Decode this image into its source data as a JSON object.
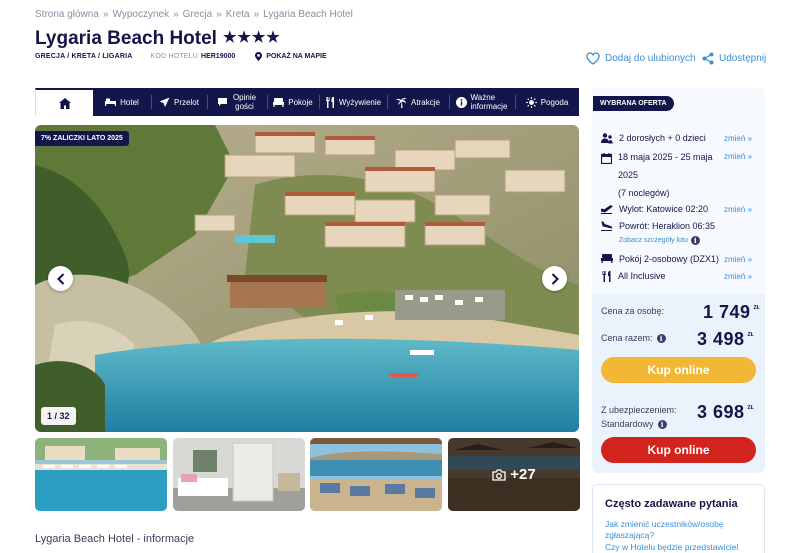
{
  "breadcrumb": [
    "Strona główna",
    "Wypoczynek",
    "Grecja",
    "Kreta",
    "Lygaria Beach Hotel"
  ],
  "hotel": {
    "name": "Lygaria Beach Hotel",
    "stars": "★★★★",
    "location": "GRECJA / KRETA / LIGARIA",
    "code_label": "KOD HOTELU",
    "code": "HER19000",
    "map_label": "POKAŻ NA MAPIE"
  },
  "actions": {
    "favorite": "Dodaj do ulubionych",
    "share": "Udostępnij"
  },
  "nav": {
    "items": [
      {
        "label": "Hotel",
        "icon": "bed-icon"
      },
      {
        "label": "Przelot",
        "icon": "plane-icon"
      },
      {
        "label": "Opinie gości",
        "icon": "comment-icon"
      },
      {
        "label": "Pokoje",
        "icon": "room-icon"
      },
      {
        "label": "Wyżywienie",
        "icon": "cutlery-icon"
      },
      {
        "label": "Atrakcje",
        "icon": "palm-icon"
      },
      {
        "label": "Ważne informacje",
        "icon": "info-icon"
      },
      {
        "label": "Pogoda",
        "icon": "sun-icon"
      }
    ]
  },
  "gallery": {
    "badge": "7% ZALICZKI LATO 2025",
    "counter": "1 / 32",
    "more": "+27"
  },
  "info_title": "Lygaria Beach Hotel - informacje",
  "offer": {
    "tag": "WYBRANA OFERTA",
    "change": "zmień »",
    "people": "2 dorosłych + 0 dzieci",
    "dates_line1": "18 maja 2025 - 25 maja",
    "dates_line2": "2025",
    "nights": "(7 noclegów)",
    "departure": "Wylot: Katowice 02:20",
    "return": "Powrót: Heraklion 06:35",
    "flight_details": "Zobacz szczegóły lotu",
    "room": "Pokój 2-osobowy (DZX1)",
    "board": "All Inclusive",
    "price_per_person_label": "Cena za osobę:",
    "price_per_person": "1 749",
    "price_total_label": "Cena razem:",
    "price_total": "3 498",
    "currency": "ZŁ",
    "book_label": "Kup online",
    "insured_label1": "Z ubezpieczeniem:",
    "insured_label2": "Standardowy",
    "price_insured": "3 698"
  },
  "faq": {
    "title": "Często zadawane pytania",
    "q1a": "Jak zmienić uczestników/osobę",
    "q1b": "zgłaszającą?",
    "q2": "Czy w Hotelu będzie przedstawiciel"
  },
  "colors": {
    "navy": "#13164a",
    "link": "#3a8fd6",
    "yellow": "#f2b735",
    "red": "#d3231d"
  }
}
